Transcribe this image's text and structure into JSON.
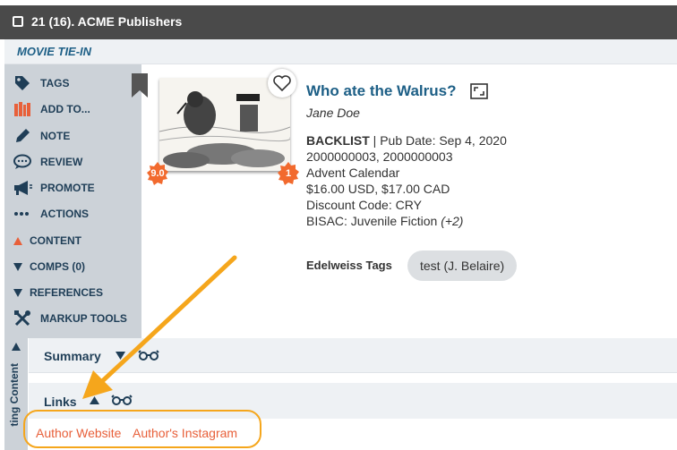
{
  "header": {
    "title": "21 (16). ACME Publishers"
  },
  "subheader": {
    "label": "MOVIE TIE-IN"
  },
  "sidebar": {
    "items": [
      {
        "label": "TAGS",
        "icon": "tag-icon"
      },
      {
        "label": "ADD TO...",
        "icon": "books-icon"
      },
      {
        "label": "NOTE",
        "icon": "pencil-icon"
      },
      {
        "label": "REVIEW",
        "icon": "chat-bubble-icon"
      },
      {
        "label": "PROMOTE",
        "icon": "megaphone-icon"
      },
      {
        "label": "ACTIONS",
        "icon": "ellipsis-icon"
      },
      {
        "label": "CONTENT",
        "icon": "triangle-up-icon"
      },
      {
        "label": "COMPS (0)",
        "icon": "triangle-down-icon"
      },
      {
        "label": "REFERENCES",
        "icon": "triangle-down-icon"
      },
      {
        "label": "MARKUP TOOLS",
        "icon": "tools-icon"
      }
    ],
    "vertical_label": "ting Content"
  },
  "book": {
    "title": "Who ate the Walrus?",
    "author": "Jane Doe",
    "status": "BACKLIST",
    "pub_date": " | Pub Date: Sep 4, 2020",
    "isbns": "2000000003, 2000000003",
    "format": "Advent Calendar",
    "price": "$16.00 USD, $17.00 CAD",
    "discount": "Discount Code: CRY",
    "bisac": "BISAC: Juvenile Fiction",
    "bisac_more": "(+2)",
    "score_badge": "9.0",
    "count_badge": "1"
  },
  "tags": {
    "label": "Edelweiss Tags",
    "pill": "test (J. Belaire)"
  },
  "sections": {
    "summary": "Summary",
    "links": "Links"
  },
  "links": {
    "author_website": "Author Website",
    "author_instagram": "Author's Instagram"
  },
  "colors": {
    "header_bg": "#4a4a4a",
    "accent_blue": "#1d5f86",
    "link_orange": "#e8603a",
    "badge_orange": "#f26a2e",
    "annotation_orange": "#f5a61c",
    "sidebar_bg": "#ccd2d8"
  }
}
